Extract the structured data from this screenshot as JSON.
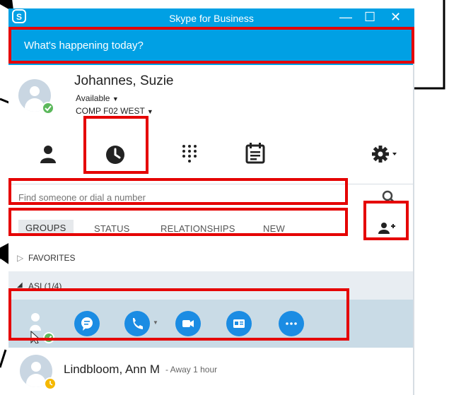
{
  "window": {
    "title": "Skype for Business",
    "minimize_icon": "minimize-icon",
    "maximize_icon": "maximize-icon",
    "close_icon": "close-icon"
  },
  "happening": {
    "placeholder": "What's happening today?"
  },
  "profile": {
    "name": "Johannes, Suzie",
    "status": "Available",
    "location": "COMP F02 WEST",
    "presence_color": "#5cb85c"
  },
  "tabs": [
    {
      "name": "contacts",
      "icon": "person-icon"
    },
    {
      "name": "conversations",
      "icon": "clock-icon"
    },
    {
      "name": "dialpad",
      "icon": "dialpad-icon"
    },
    {
      "name": "meetings",
      "icon": "calendar-icon"
    },
    {
      "name": "options",
      "icon": "gear-icon"
    }
  ],
  "search": {
    "placeholder": "Find someone or dial a number"
  },
  "filters": {
    "groups": "GROUPS",
    "status": "STATUS",
    "relationships": "RELATIONSHIPS",
    "new": "NEW"
  },
  "groups": {
    "favorites": "FAVORITES",
    "asi": "ASI (1/4)"
  },
  "contacts": [
    {
      "name": "Lindbloom, Ann M",
      "status": " - Away 1 hour",
      "presence_color": "#f5b800"
    }
  ],
  "colors": {
    "accent": "#00a0e4",
    "highlight": "#e50000",
    "action": "#1b8ce3"
  }
}
